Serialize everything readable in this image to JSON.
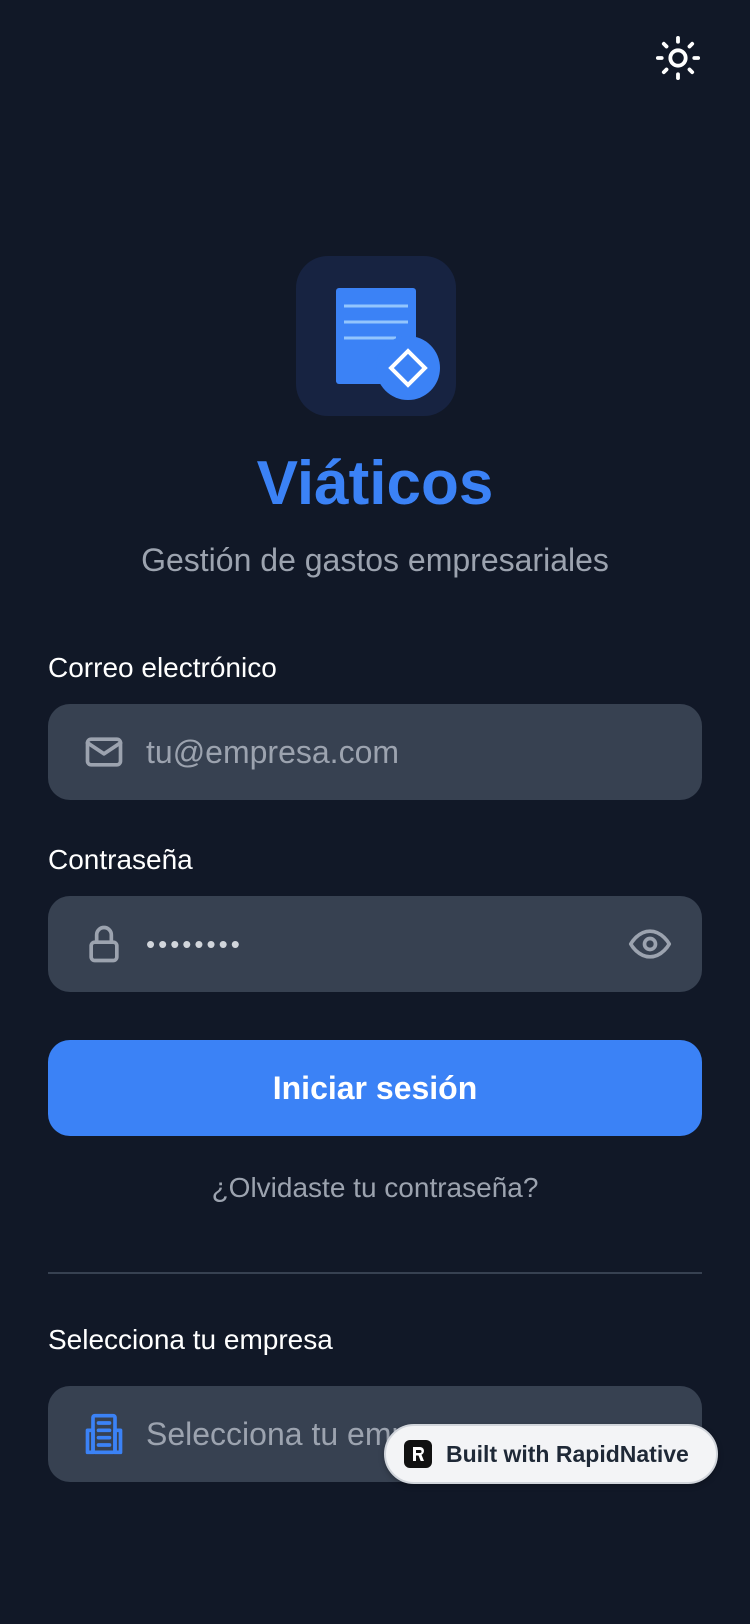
{
  "theme_toggle": {
    "icon": "sun-icon"
  },
  "logo": {
    "icon": "receipt-document-icon",
    "accent": "#3b82f6"
  },
  "app": {
    "title": "Viáticos",
    "subtitle": "Gestión de gastos empresariales"
  },
  "form": {
    "email": {
      "label": "Correo electrónico",
      "placeholder": "tu@empresa.com",
      "icon": "mail-icon"
    },
    "password": {
      "label": "Contraseña",
      "value_masked": "••••••••",
      "icon": "lock-icon",
      "toggle_icon": "eye-icon"
    },
    "submit_label": "Iniciar sesión",
    "forgot_label": "¿Olvidaste tu contraseña?"
  },
  "company": {
    "label": "Selecciona tu empresa",
    "placeholder": "Selecciona tu empresa",
    "icon": "building-icon"
  },
  "badge": {
    "label": "Built with RapidNative",
    "icon": "rapidnative-logo-icon"
  },
  "colors": {
    "background": "#111827",
    "input_bg": "#374151",
    "primary": "#3b82f6",
    "muted_text": "#9ca3af"
  }
}
